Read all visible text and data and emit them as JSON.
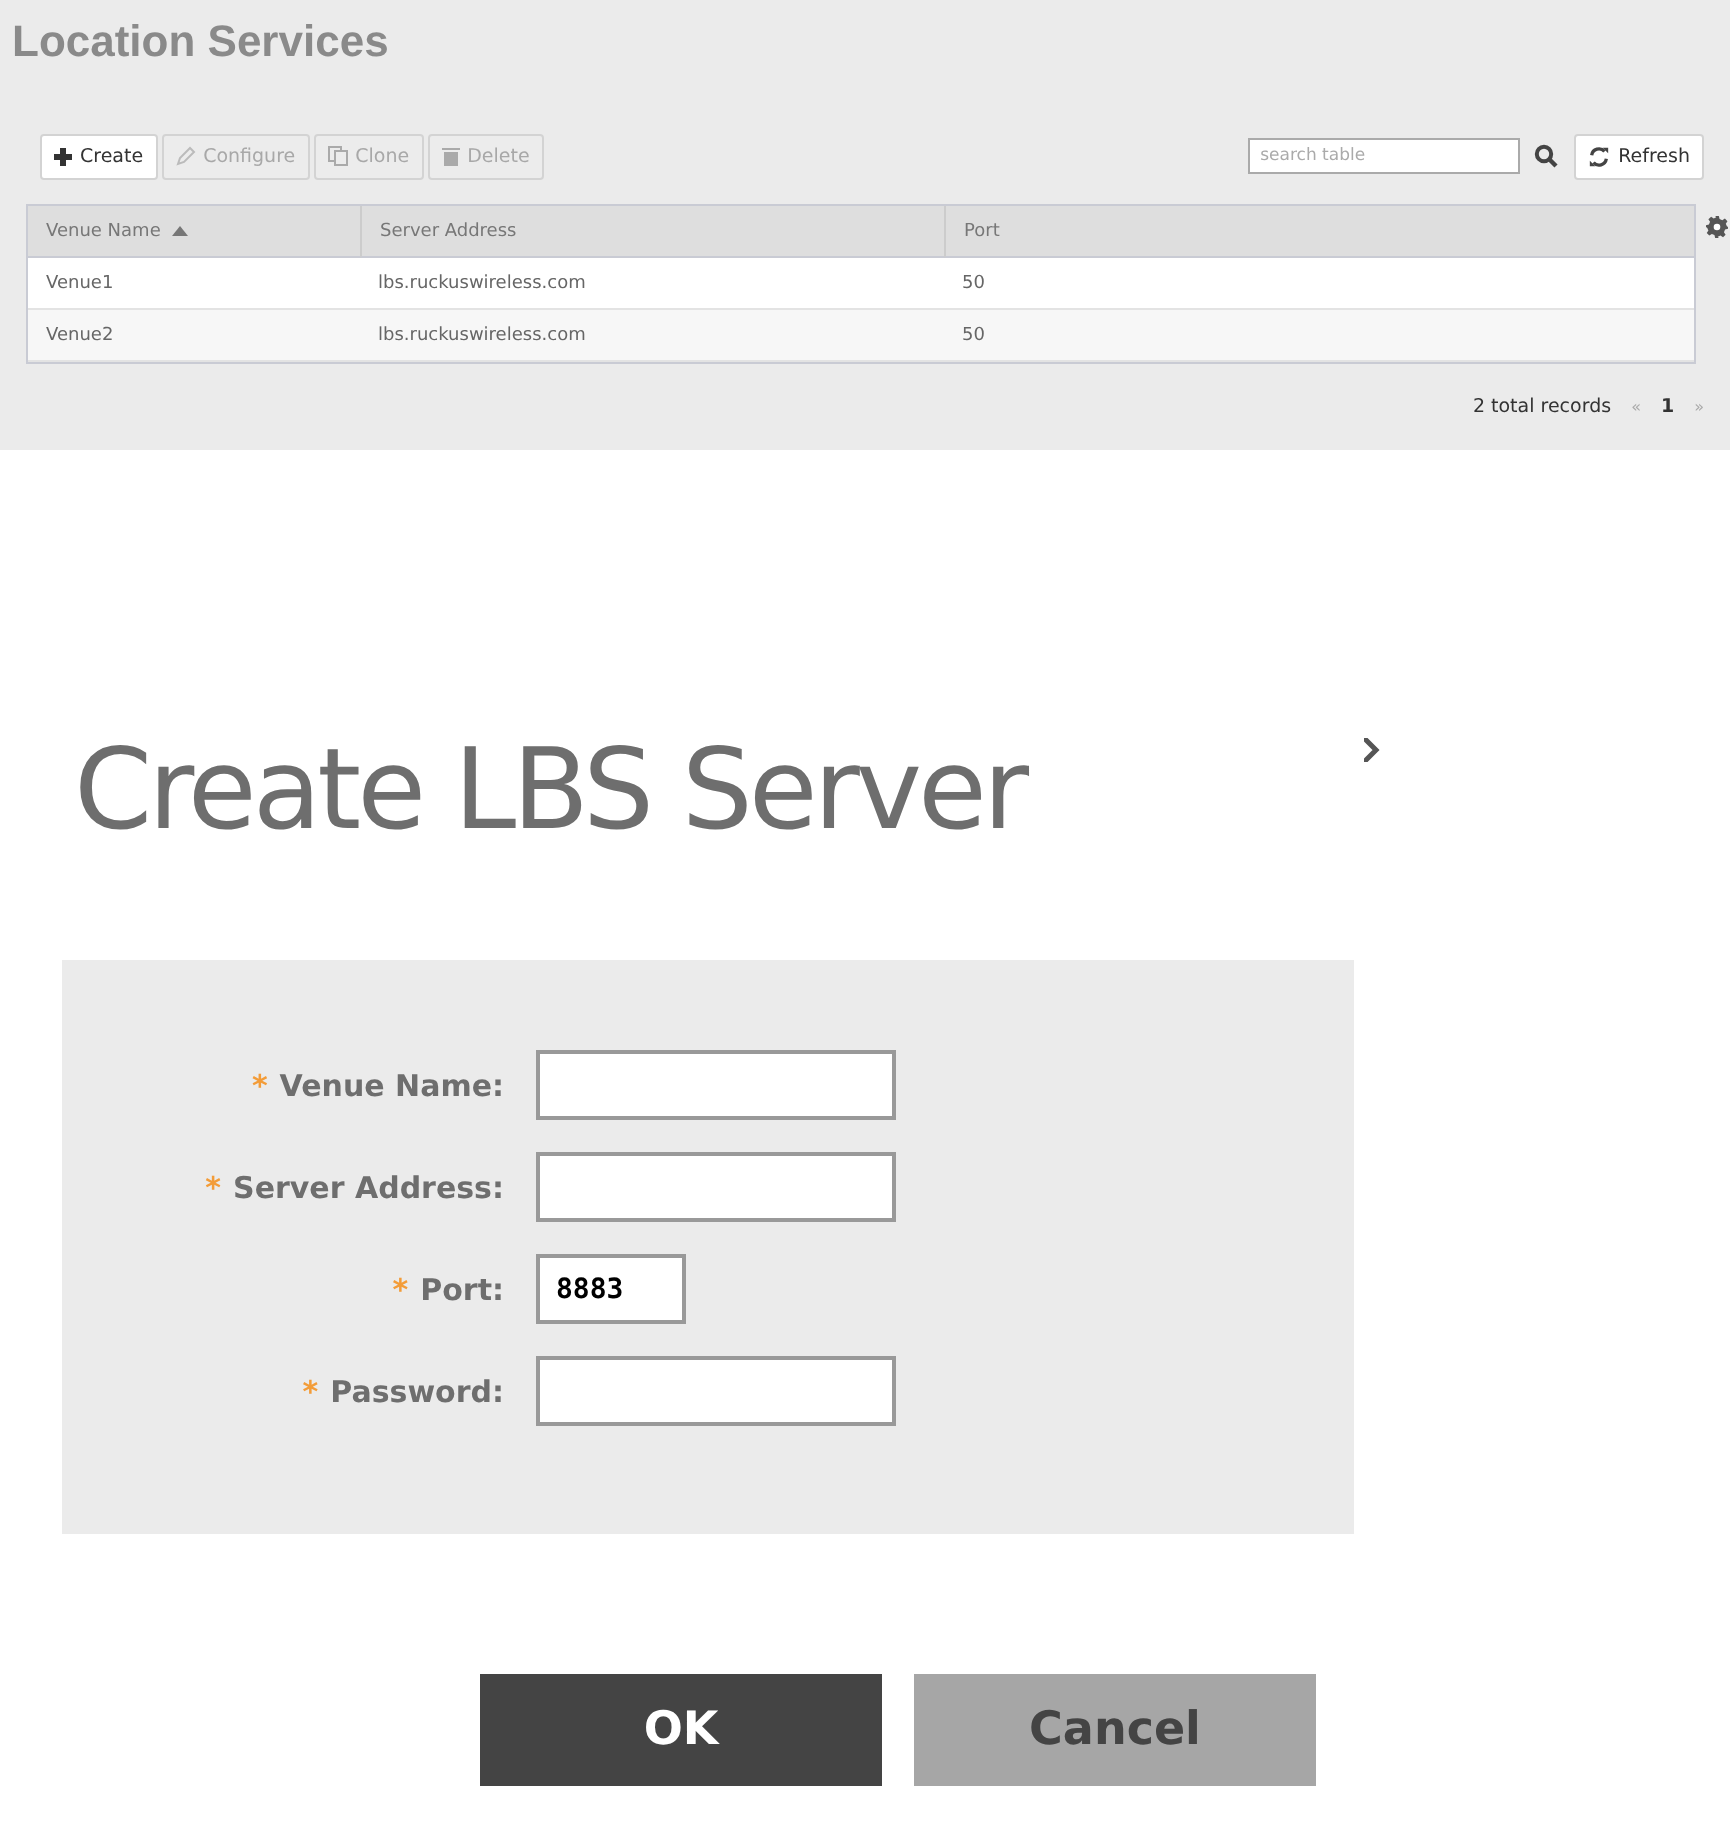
{
  "page": {
    "title": "Location Services"
  },
  "toolbar": [
    {
      "kind": "create",
      "label": "Create",
      "disabled": false
    },
    {
      "kind": "configure",
      "label": "Configure",
      "disabled": true
    },
    {
      "kind": "clone",
      "label": "Clone",
      "disabled": true
    },
    {
      "kind": "delete",
      "label": "Delete",
      "disabled": true
    }
  ],
  "search": {
    "placeholder": "search table"
  },
  "refresh": {
    "label": "Refresh"
  },
  "table": {
    "columns": [
      {
        "label": "Venue Name",
        "sorted": true
      },
      {
        "label": "Server Address",
        "sorted": false
      },
      {
        "label": "Port",
        "sorted": false
      }
    ],
    "rows": [
      [
        "Venue1",
        "lbs.ruckuswireless.com",
        "50"
      ],
      [
        "Venue2",
        "lbs.ruckuswireless.com",
        "50"
      ]
    ]
  },
  "pagination": {
    "total": "2 total records",
    "prev": "«",
    "page": "1",
    "next": "»"
  },
  "dialog": {
    "title": "Create LBS Server",
    "fields": [
      {
        "kind": "long",
        "marker": "*",
        "label": "Venue Name:"
      },
      {
        "kind": "long",
        "marker": "*",
        "label": "Server Address:"
      },
      {
        "kind": "short",
        "marker": "*",
        "label": "Port:",
        "value": "8883"
      },
      {
        "kind": "long",
        "marker": "*",
        "label": "Password:"
      }
    ],
    "buttons": [
      {
        "kind": "primary",
        "label": "OK"
      },
      {
        "kind": "secondary",
        "label": "Cancel"
      }
    ]
  }
}
